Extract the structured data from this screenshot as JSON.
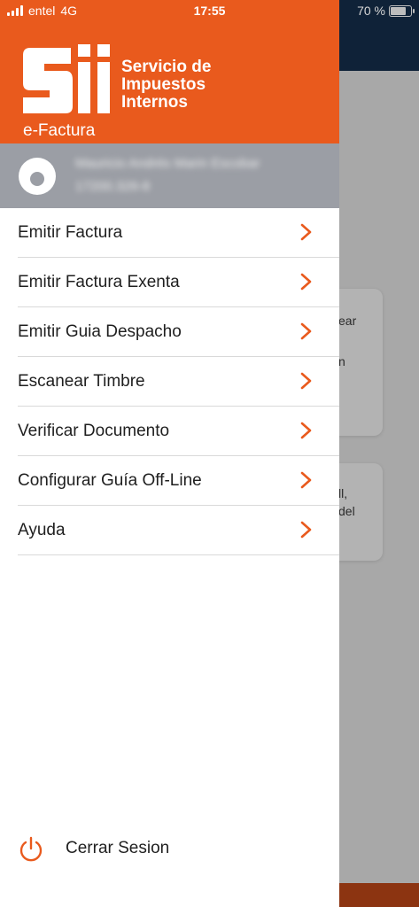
{
  "status_bar": {
    "carrier": "entel",
    "network": "4G",
    "time": "17:55",
    "battery_text": "70 %",
    "battery_level": 0.7
  },
  "brand": {
    "logo_wordmark": "Sii",
    "name_line1": "Servicio de",
    "name_line2": "Impuestos",
    "name_line3": "Internos",
    "subtitle": "e-Factura",
    "color": "#e95a1d"
  },
  "user": {
    "name": "Mauricio Andrés Marin Escobar",
    "rut": "17200.326-8"
  },
  "menu": [
    {
      "label": "Emitir Factura",
      "icon": "chevron-right-icon"
    },
    {
      "label": "Emitir Factura Exenta",
      "icon": "chevron-right-icon"
    },
    {
      "label": "Emitir Guia Despacho",
      "icon": "chevron-right-icon"
    },
    {
      "label": "Escanear Timbre",
      "icon": "chevron-right-icon"
    },
    {
      "label": "Verificar Documento",
      "icon": "chevron-right-icon"
    },
    {
      "label": "Configurar Guía Off-Line",
      "icon": "chevron-right-icon"
    },
    {
      "label": "Ayuda",
      "icon": "chevron-right-icon"
    }
  ],
  "logout": {
    "label": "Cerrar Sesion",
    "icon": "power-icon"
  },
  "background": {
    "card1_lines": [
      "ear",
      "",
      "n"
    ],
    "card2_lines": [
      "ll,",
      "del"
    ]
  }
}
